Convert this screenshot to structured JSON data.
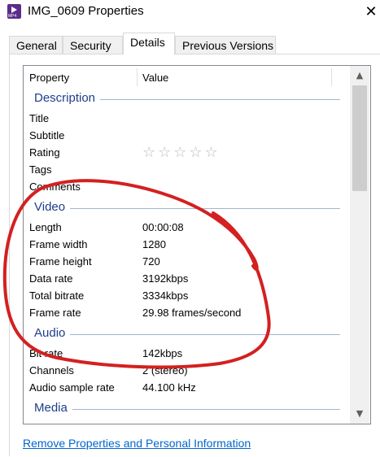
{
  "window": {
    "title": "IMG_0609 Properties",
    "icon": "mp4-video-icon",
    "icon_label": "MP4",
    "close_glyph": "✕"
  },
  "tabs": [
    {
      "label": "General"
    },
    {
      "label": "Security"
    },
    {
      "label": "Details",
      "active": true
    },
    {
      "label": "Previous Versions"
    }
  ],
  "list": {
    "columns": {
      "property": "Property",
      "value": "Value"
    },
    "sections": {
      "description": {
        "label": "Description",
        "rows": [
          {
            "name": "Title",
            "value": ""
          },
          {
            "name": "Subtitle",
            "value": ""
          },
          {
            "name": "Rating",
            "value": "",
            "stars": "☆☆☆☆☆",
            "star_count": 0,
            "star_max": 5
          },
          {
            "name": "Tags",
            "value": ""
          },
          {
            "name": "Comments",
            "value": ""
          }
        ]
      },
      "video": {
        "label": "Video",
        "rows": [
          {
            "name": "Length",
            "value": "00:00:08"
          },
          {
            "name": "Frame width",
            "value": "1280"
          },
          {
            "name": "Frame height",
            "value": "720"
          },
          {
            "name": "Data rate",
            "value": "3192kbps"
          },
          {
            "name": "Total bitrate",
            "value": "3334kbps"
          },
          {
            "name": "Frame rate",
            "value": "29.98 frames/second"
          }
        ]
      },
      "audio": {
        "label": "Audio",
        "rows": [
          {
            "name": "Bit rate",
            "value": "142kbps"
          },
          {
            "name": "Channels",
            "value": "2 (stereo)"
          },
          {
            "name": "Audio sample rate",
            "value": "44.100 kHz"
          }
        ]
      },
      "media": {
        "label": "Media",
        "rows": []
      }
    }
  },
  "scrollbar": {
    "up_glyph": "▲",
    "down_glyph": "▼"
  },
  "footer": {
    "link_text": "Remove Properties and Personal Information"
  },
  "colors": {
    "section_label": "#1e3e8c",
    "link": "#0066cc",
    "annotation": "#d42020"
  }
}
